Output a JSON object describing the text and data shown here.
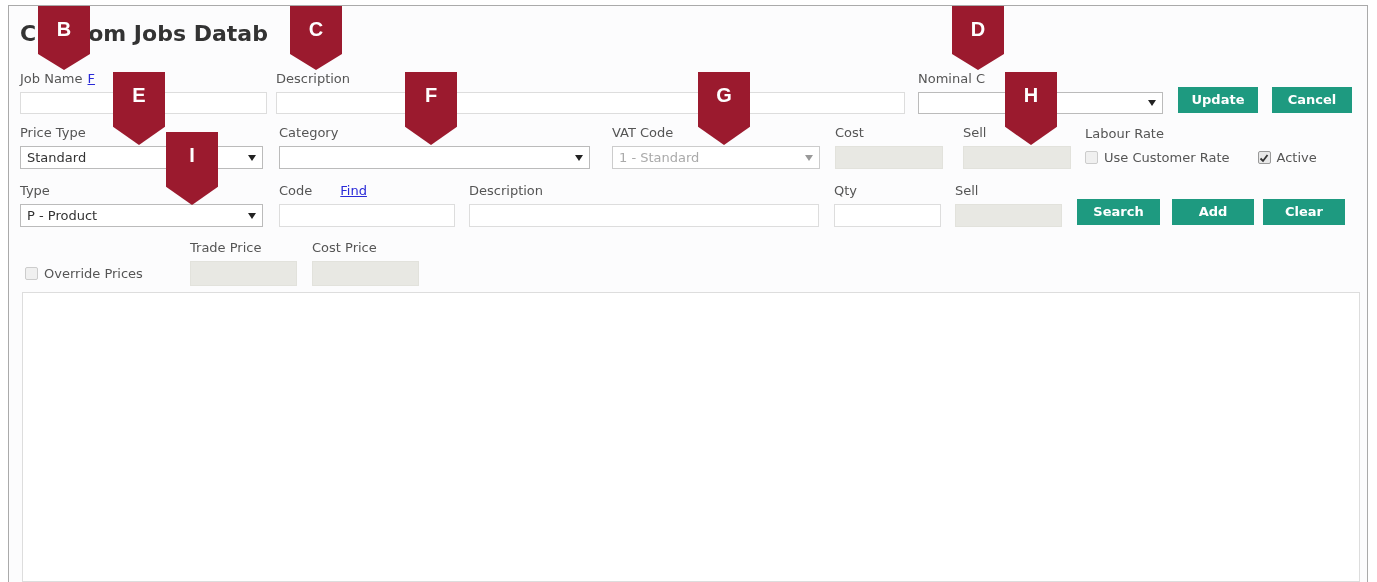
{
  "title_parts": [
    "C",
    "om Jobs Datab"
  ],
  "row1": {
    "fields": [
      {
        "kind": "text",
        "label": "Job Name",
        "link": "F"
      },
      {
        "kind": "text",
        "label": "Description"
      },
      {
        "kind": "select",
        "label": "Nominal C"
      }
    ],
    "buttons": [
      "Update",
      "Cancel"
    ]
  },
  "row2": {
    "fields": [
      {
        "kind": "select",
        "label": "Price Type",
        "value": "Standard",
        "disabled": false
      },
      {
        "kind": "select",
        "label": "Category",
        "disabled": false
      },
      {
        "kind": "select",
        "label": "VAT Code",
        "value": "1 - Standard",
        "disabled": true
      },
      {
        "kind": "text",
        "label": "Cost",
        "disabled": true
      },
      {
        "kind": "text",
        "label": "Sell",
        "disabled": true
      }
    ],
    "labour": {
      "label": "Labour Rate",
      "checks": [
        {
          "label": "Use Customer Rate",
          "checked": false
        },
        {
          "label": "Active",
          "checked": true
        }
      ]
    }
  },
  "row3": {
    "fields": [
      {
        "kind": "select",
        "label": "Type",
        "value": "P - Product",
        "disabled": false
      },
      {
        "kind": "text",
        "label": "Code",
        "link": "Find",
        "disabled": false
      },
      {
        "kind": "text",
        "label": "Description",
        "disabled": false
      },
      {
        "kind": "text",
        "label": "Qty",
        "disabled": false
      },
      {
        "kind": "text",
        "label": "Sell",
        "disabled": true
      }
    ],
    "buttons": [
      "Search",
      "Add",
      "Clear"
    ]
  },
  "row4": {
    "override": {
      "label": "Override Prices",
      "checked": false
    },
    "fields": [
      {
        "kind": "text",
        "label": "Trade Price",
        "disabled": true
      },
      {
        "kind": "text",
        "label": "Cost Price",
        "disabled": true
      }
    ]
  },
  "markers": [
    {
      "label": "B"
    },
    {
      "label": "C"
    },
    {
      "label": "D"
    },
    {
      "label": "E"
    },
    {
      "label": "F"
    },
    {
      "label": "G"
    },
    {
      "label": "H"
    },
    {
      "label": "I"
    }
  ]
}
